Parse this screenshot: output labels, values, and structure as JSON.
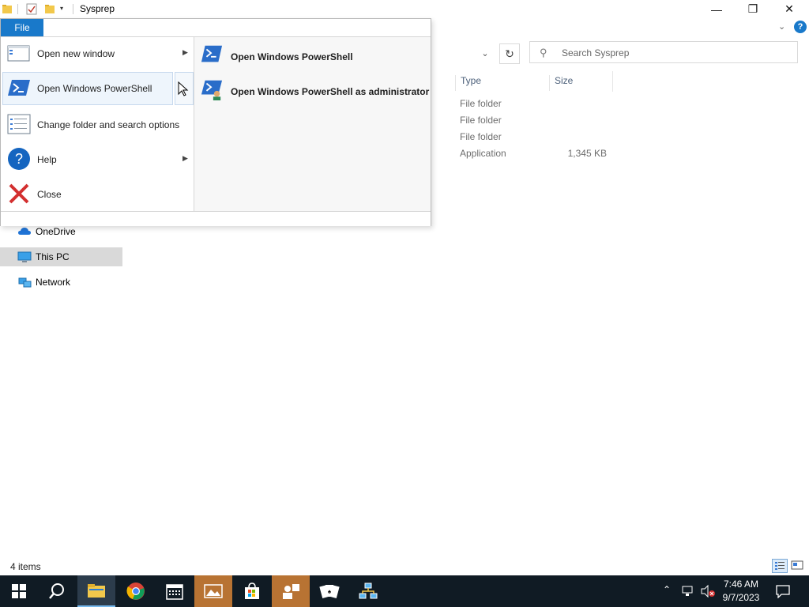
{
  "window": {
    "title": "Sysprep",
    "controls": {
      "minimize": "—",
      "maximize": "❐",
      "close": "✕"
    }
  },
  "ribbon": {
    "file_tab": "File",
    "expand_icon": "chevron-down-icon",
    "help_icon": "help-icon"
  },
  "search": {
    "placeholder": "Search Sysprep"
  },
  "columns": {
    "type": "Type",
    "size": "Size"
  },
  "files": [
    {
      "type": "File folder",
      "size": ""
    },
    {
      "type": "File folder",
      "size": ""
    },
    {
      "type": "File folder",
      "size": ""
    },
    {
      "type": "Application",
      "size": "1,345 KB"
    }
  ],
  "nav": {
    "items": [
      {
        "label": "OneDrive",
        "icon": "cloud-icon"
      },
      {
        "label": "This PC",
        "icon": "computer-icon",
        "selected": true
      },
      {
        "label": "Network",
        "icon": "network-icon"
      }
    ]
  },
  "file_menu": {
    "left": [
      {
        "label": "Open new window",
        "has_submenu": true
      },
      {
        "label": "Open Windows PowerShell",
        "has_submenu": true,
        "selected": true
      },
      {
        "label": "Change folder and search options",
        "has_submenu": false
      },
      {
        "label": "Help",
        "has_submenu": true
      },
      {
        "label": "Close",
        "has_submenu": false
      }
    ],
    "right": [
      {
        "label": "Open Windows PowerShell"
      },
      {
        "label": "Open Windows PowerShell as administrator"
      }
    ]
  },
  "status": {
    "items": "4 items"
  },
  "taskbar": {
    "time": "7:46 AM",
    "date": "9/7/2023",
    "pinned": [
      "start-icon",
      "search-icon",
      "file-explorer-icon",
      "chrome-icon",
      "calendar-icon",
      "photos-icon",
      "store-icon",
      "people-icon",
      "solitaire-icon",
      "network-app-icon"
    ]
  }
}
